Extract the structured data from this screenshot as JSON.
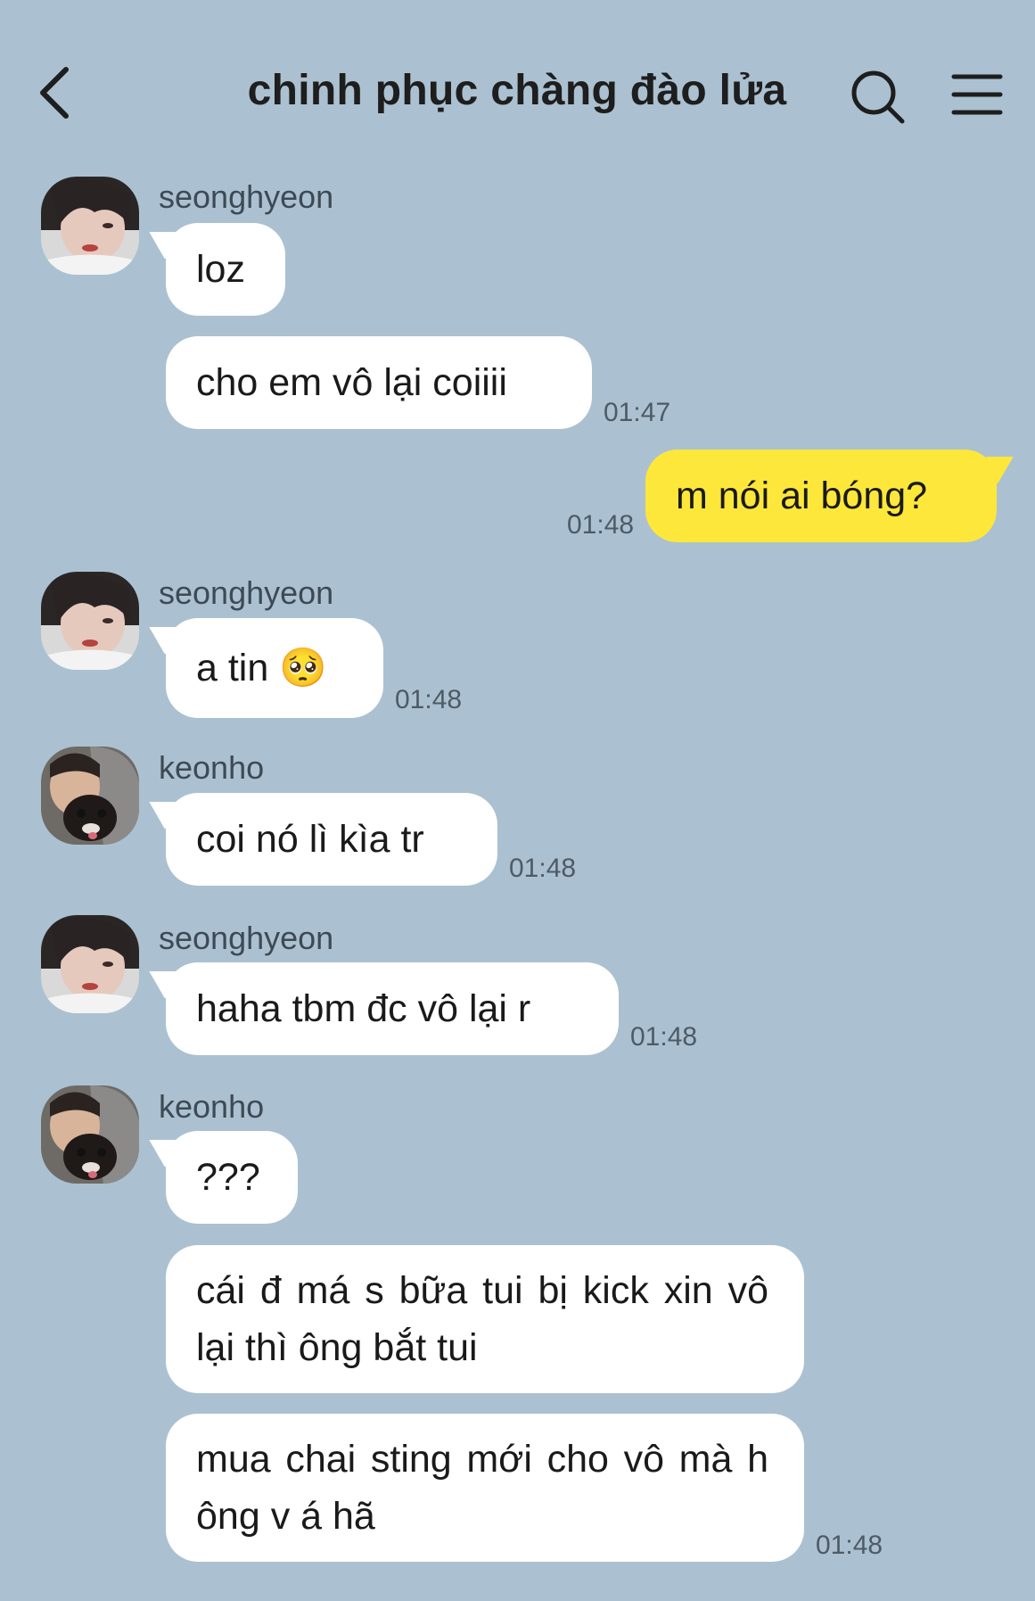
{
  "header": {
    "title": "chinh phục chàng đào lửa",
    "back_icon": "chevron-left-icon",
    "search_icon": "search-icon",
    "menu_icon": "hamburger-menu-icon"
  },
  "colors": {
    "background": "#abc1d1",
    "my_bubble": "#fde73a",
    "other_bubble": "#ffffff"
  },
  "messages": [
    {
      "sender": "seonghyeon",
      "text": "loz",
      "time": ""
    },
    {
      "sender": "",
      "text": "cho em vô lại coiiii",
      "time": "01:47"
    },
    {
      "sender": "",
      "text": "m nói ai bóng?",
      "time": "01:48",
      "mine": true
    },
    {
      "sender": "seonghyeon",
      "text": "a tin 🥺",
      "time": "01:48"
    },
    {
      "sender": "keonho",
      "text": "coi nó lì kìa tr",
      "time": "01:48"
    },
    {
      "sender": "seonghyeon",
      "text": "haha tbm đc vô lại r",
      "time": "01:48"
    },
    {
      "sender": "keonho",
      "text": "???",
      "time": ""
    },
    {
      "sender": "",
      "text": "cái đ má s bữa tui bị kick xin vô lại thì ông bắt tui",
      "time": ""
    },
    {
      "sender": "",
      "text": "mua chai sting mới cho vô mà h ông v á hã",
      "time": "01:48"
    }
  ]
}
